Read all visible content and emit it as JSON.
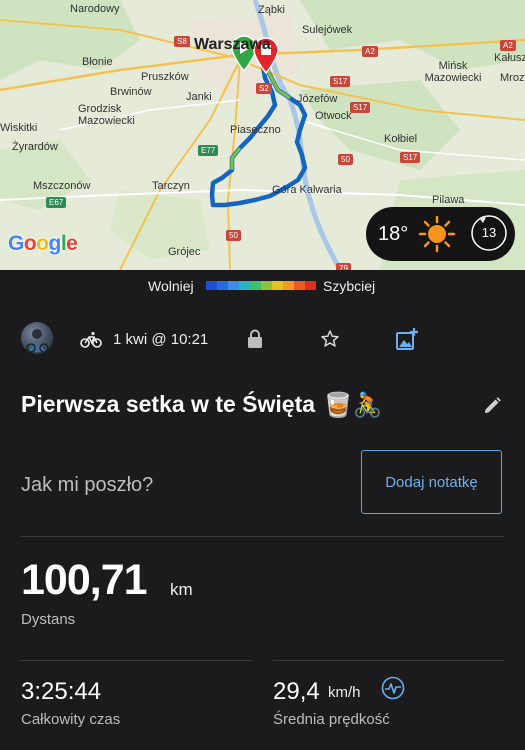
{
  "map": {
    "city_label": "Warszawa",
    "place_labels": [
      "Narodowy",
      "Ząbki",
      "Sulejówek",
      "Błonie",
      "Pruszków",
      "Brwinów",
      "Janki",
      "Grodzisk Mazowiecki",
      "Piaseczno",
      "Józefów",
      "Otwock",
      "Mińsk Mazowiecki",
      "Kałusz",
      "Żyrardów",
      "Wiskitki",
      "Mszczonów",
      "Tarczyn",
      "Góra Kalwaria",
      "Grójec",
      "Kołbiel",
      "Pilawa",
      "Mrozy"
    ],
    "road_signs": [
      "A2",
      "S8",
      "S2",
      "S17",
      "S17",
      "E77",
      "E67",
      "50",
      "50",
      "S17",
      "A2",
      "79"
    ],
    "attribution": "Google"
  },
  "weather": {
    "temperature": "18°",
    "wind_speed": "13",
    "condition_icon": "sun-icon"
  },
  "legend": {
    "slow_label": "Wolniej",
    "fast_label": "Szybciej",
    "colors": [
      "#1e4fd6",
      "#2a6be0",
      "#3d8ce8",
      "#2bb3c9",
      "#3fbf73",
      "#8bc43c",
      "#e2c21f",
      "#f39a1e",
      "#ee5a21",
      "#e02d22"
    ]
  },
  "activity": {
    "date": "1 kwi @ 10:21",
    "type_icon": "bike-icon",
    "title": "Pierwsza setka w te Święta",
    "title_emojis": "🥃🚴",
    "note_prompt": "Jak mi poszło?",
    "note_button": "Dodaj notatkę"
  },
  "stats": {
    "distance_value": "100,71",
    "distance_unit": "km",
    "distance_label": "Dystans",
    "time_value": "3:25:44",
    "time_label": "Całkowity czas",
    "speed_value": "29,4",
    "speed_unit": "km/h",
    "speed_label": "Średnia prędkość"
  },
  "colors": {
    "accent": "#6ab0ef",
    "route": "#1565c0",
    "start": "#2fa843",
    "end": "#e3242b"
  }
}
